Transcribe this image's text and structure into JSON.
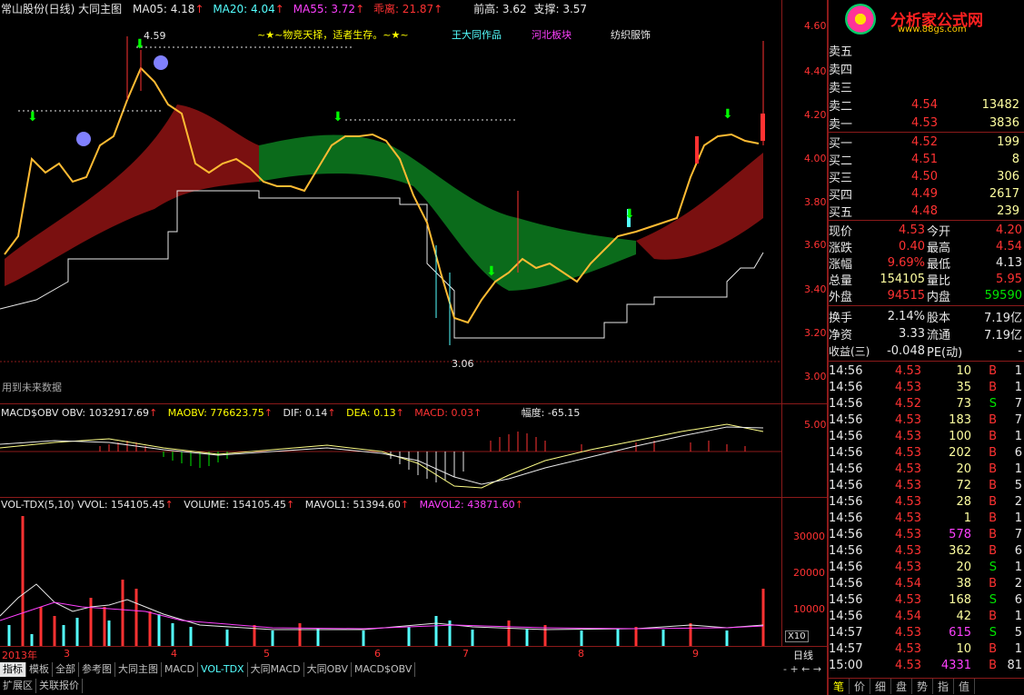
{
  "header": {
    "title": "常山股份(日线) 大同主图",
    "ma05": "MA05: 4.18",
    "ma20": "MA20: 4.04",
    "ma55": "MA55: 3.72",
    "guaili": "乖离: 21.87",
    "qiangao": "前高: 3.62",
    "zhicheng": "支撑: 3.57"
  },
  "banner": {
    "slogan": "~★~物竞天择，适者生存。~★~",
    "author": "王大同作品",
    "sector1": "河北板块",
    "sector2": "纺织服饰"
  },
  "logo": {
    "text": "分析家公式网",
    "url": "www.88gs.com"
  },
  "main_chart": {
    "high_label": "4.59",
    "low_label": "3.06",
    "note": "用到未来数据",
    "ticks": [
      "4.60",
      "4.40",
      "4.20",
      "4.00",
      "3.80",
      "3.60",
      "3.40",
      "3.20",
      "3.00"
    ]
  },
  "macd_panel": {
    "name": "MACD$OBV",
    "obv": "OBV: 1032917.69",
    "maobv": "MAOBV: 776623.75",
    "dif": "DIF: 0.14",
    "dea": "DEA: 0.13",
    "macd": "MACD: 0.03",
    "fudu": "幅度: -65.15",
    "tick": "5.00"
  },
  "vol_panel": {
    "name": "VOL-TDX(5,10)",
    "vvol": "VVOL: 154105.45",
    "volume": "VOLUME: 154105.45",
    "mavol1": "MAVOL1: 51394.60",
    "mavol2": "MAVOL2: 43871.60",
    "ticks": [
      "30000",
      "20000",
      "10000"
    ],
    "unit": "X10"
  },
  "time_axis": {
    "year": "2013年",
    "months": [
      "3",
      "4",
      "5",
      "6",
      "7",
      "8",
      "9"
    ],
    "period": "日线"
  },
  "tabs": [
    "指标",
    "模板",
    "全部",
    "参考图",
    "大同主图",
    "MACD",
    "VOL-TDX",
    "大同MACD",
    "大同OBV",
    "MACD$OBV"
  ],
  "bottom_tabs": [
    "扩展区",
    "关联报价"
  ],
  "order_book": {
    "sells": [
      {
        "label": "卖五",
        "price": "",
        "vol": ""
      },
      {
        "label": "卖四",
        "price": "",
        "vol": ""
      },
      {
        "label": "卖三",
        "price": "",
        "vol": ""
      },
      {
        "label": "卖二",
        "price": "4.54",
        "vol": "13482"
      },
      {
        "label": "卖一",
        "price": "4.53",
        "vol": "3836"
      }
    ],
    "buys": [
      {
        "label": "买一",
        "price": "4.52",
        "vol": "199"
      },
      {
        "label": "买二",
        "price": "4.51",
        "vol": "8"
      },
      {
        "label": "买三",
        "price": "4.50",
        "vol": "306"
      },
      {
        "label": "买四",
        "price": "4.49",
        "vol": "2617"
      },
      {
        "label": "买五",
        "price": "4.48",
        "vol": "239"
      }
    ]
  },
  "quote": [
    {
      "l1": "现价",
      "v1": "4.53",
      "l2": "今开",
      "v2": "4.20"
    },
    {
      "l1": "涨跌",
      "v1": "0.40",
      "l2": "最高",
      "v2": "4.54"
    },
    {
      "l1": "涨幅",
      "v1": "9.69%",
      "l2": "最低",
      "v2": "4.13"
    },
    {
      "l1": "总量",
      "v1": "154105",
      "l2": "量比",
      "v2": "5.95"
    },
    {
      "l1": "外盘",
      "v1": "94515",
      "l2": "内盘",
      "v2": "59590"
    }
  ],
  "fundamentals": [
    {
      "l1": "换手",
      "v1": "2.14%",
      "l2": "股本",
      "v2": "7.19亿"
    },
    {
      "l1": "净资",
      "v1": "3.33",
      "l2": "流通",
      "v2": "7.19亿"
    },
    {
      "l1": "收益(三)",
      "v1": "-0.048",
      "l2": "PE(动)",
      "v2": "-"
    }
  ],
  "ticks_list": [
    {
      "t": "14:56",
      "p": "4.53",
      "v": "10",
      "s": "B",
      "n": "1"
    },
    {
      "t": "14:56",
      "p": "4.53",
      "v": "35",
      "s": "B",
      "n": "1"
    },
    {
      "t": "14:56",
      "p": "4.52",
      "v": "73",
      "s": "S",
      "n": "7"
    },
    {
      "t": "14:56",
      "p": "4.53",
      "v": "183",
      "s": "B",
      "n": "7"
    },
    {
      "t": "14:56",
      "p": "4.53",
      "v": "100",
      "s": "B",
      "n": "1"
    },
    {
      "t": "14:56",
      "p": "4.53",
      "v": "202",
      "s": "B",
      "n": "6"
    },
    {
      "t": "14:56",
      "p": "4.53",
      "v": "20",
      "s": "B",
      "n": "1"
    },
    {
      "t": "14:56",
      "p": "4.53",
      "v": "72",
      "s": "B",
      "n": "5"
    },
    {
      "t": "14:56",
      "p": "4.53",
      "v": "28",
      "s": "B",
      "n": "2"
    },
    {
      "t": "14:56",
      "p": "4.53",
      "v": "1",
      "s": "B",
      "n": "1"
    },
    {
      "t": "14:56",
      "p": "4.53",
      "v": "578",
      "s": "B",
      "n": "7"
    },
    {
      "t": "14:56",
      "p": "4.53",
      "v": "362",
      "s": "B",
      "n": "6"
    },
    {
      "t": "14:56",
      "p": "4.53",
      "v": "20",
      "s": "S",
      "n": "1"
    },
    {
      "t": "14:56",
      "p": "4.54",
      "v": "38",
      "s": "B",
      "n": "2"
    },
    {
      "t": "14:56",
      "p": "4.53",
      "v": "168",
      "s": "S",
      "n": "6"
    },
    {
      "t": "14:56",
      "p": "4.54",
      "v": "42",
      "s": "B",
      "n": "1"
    },
    {
      "t": "14:57",
      "p": "4.53",
      "v": "615",
      "s": "S",
      "n": "5"
    },
    {
      "t": "14:57",
      "p": "4.53",
      "v": "10",
      "s": "B",
      "n": "1"
    },
    {
      "t": "15:00",
      "p": "4.53",
      "v": "4331",
      "s": "B",
      "n": "81"
    }
  ],
  "panel_tabs": [
    "笔",
    "价",
    "细",
    "盘",
    "势",
    "指",
    "值"
  ],
  "colors": {
    "up": "#ff3232",
    "down": "#54ffff",
    "bg": "#000000",
    "grid": "#8b1a1a"
  }
}
